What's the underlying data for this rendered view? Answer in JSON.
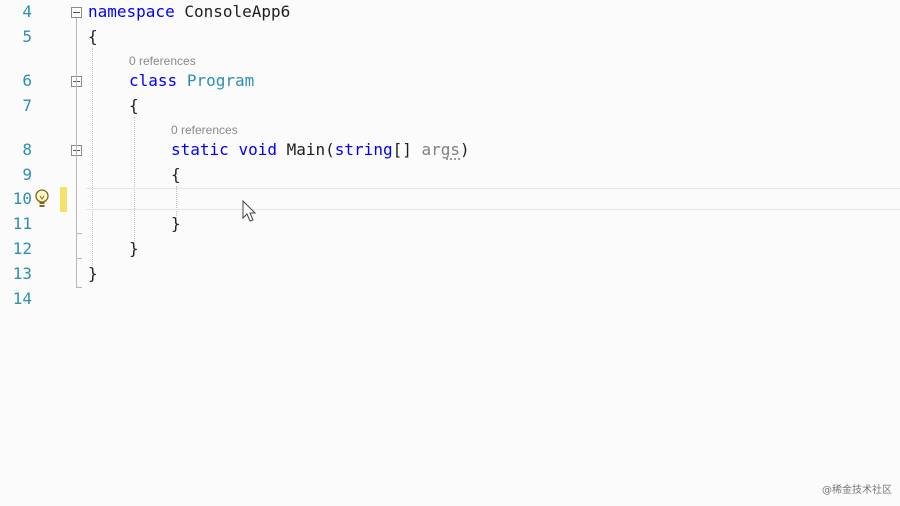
{
  "editor": {
    "line_numbers": [
      "4",
      "5",
      "6",
      "7",
      "8",
      "9",
      "10",
      "11",
      "12",
      "13",
      "14"
    ],
    "code_lens": {
      "class_refs": "0 references",
      "method_refs": "0 references"
    },
    "tokens": {
      "kw_namespace": "namespace",
      "ns_name": "ConsoleApp6",
      "open_brace": "{",
      "close_brace": "}",
      "kw_class": "class",
      "class_name": "Program",
      "kw_static": "static",
      "kw_void": "void",
      "method_name": "Main(",
      "kw_string": "string",
      "brackets": "[] ",
      "param_name": "args",
      "close_paren": ")"
    },
    "colors": {
      "keyword": "#0000ff",
      "type": "#2b91af",
      "line_number": "#2b91af",
      "change_bar": "#f5e26a"
    }
  },
  "watermark": "@稀金技术社区"
}
